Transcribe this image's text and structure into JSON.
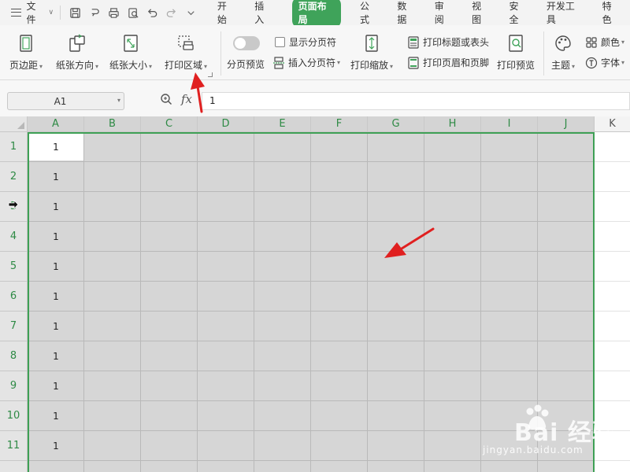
{
  "menu": {
    "file_label": "文件",
    "tabs": [
      {
        "label": "开始"
      },
      {
        "label": "插入"
      },
      {
        "label": "页面布局",
        "active": true
      },
      {
        "label": "公式"
      },
      {
        "label": "数据"
      },
      {
        "label": "审阅"
      },
      {
        "label": "视图"
      },
      {
        "label": "安全"
      },
      {
        "label": "开发工具"
      },
      {
        "label": "特色"
      }
    ]
  },
  "ribbon": {
    "margins": "页边距",
    "orientation": "纸张方向",
    "size": "纸张大小",
    "print_area": "打印区域",
    "page_break_preview": "分页预览",
    "show_page_breaks": "显示分页符",
    "insert_page_break": "插入分页符",
    "print_scale": "打印缩放",
    "print_titles": "打印标题或表头",
    "print_header_footer": "打印页眉和页脚",
    "print_preview": "打印预览",
    "theme": "主题",
    "colors": "颜色",
    "fonts": "字体"
  },
  "formula_bar": {
    "name_box": "A1",
    "fx": "fx",
    "value": "1"
  },
  "grid": {
    "columns": [
      "A",
      "B",
      "C",
      "D",
      "E",
      "F",
      "G",
      "H",
      "I",
      "J",
      "K"
    ],
    "rows": [
      "1",
      "2",
      "3",
      "4",
      "5",
      "6",
      "7",
      "8",
      "9",
      "10",
      "11"
    ],
    "col_a_values": [
      "1",
      "1",
      "1",
      "1",
      "1",
      "1",
      "1",
      "1",
      "1",
      "1",
      "1"
    ]
  },
  "colors": {
    "accent_green": "#3fa35a",
    "annotation_red": "#e02020"
  },
  "watermark": {
    "brand": "Bai 经验",
    "url": "jingyan.baidu.com"
  }
}
